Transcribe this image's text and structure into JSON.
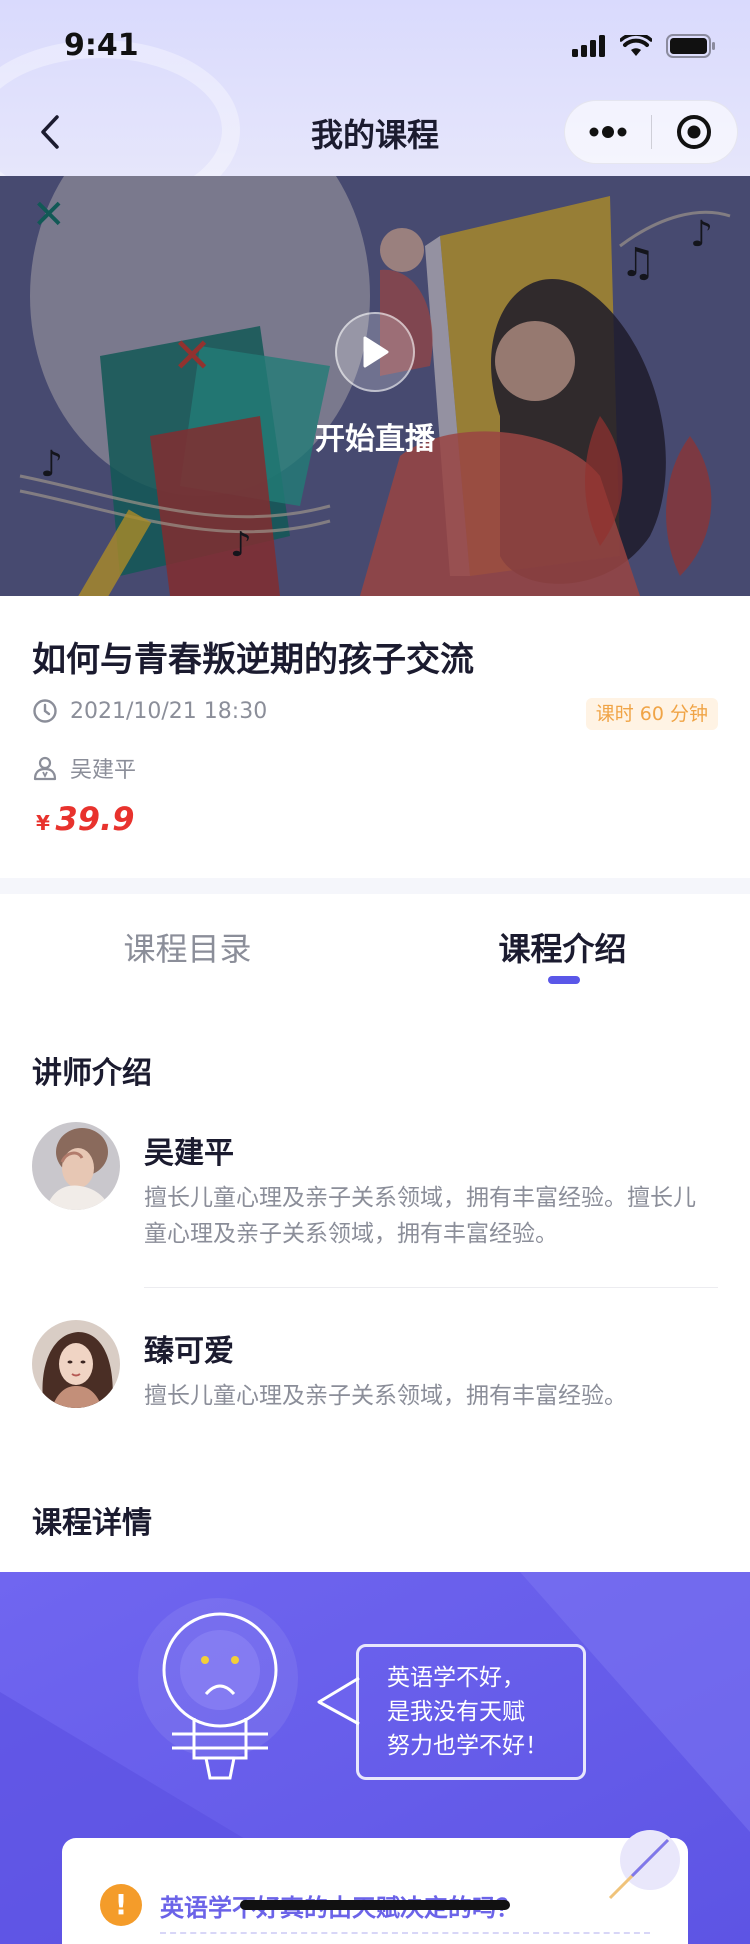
{
  "status_bar": {
    "time": "9:41",
    "icons": [
      "signal-icon",
      "wifi-icon",
      "battery-icon"
    ]
  },
  "nav": {
    "title": "我的课程",
    "back_icon": "chevron-left-icon",
    "more_icon": "more-dots-icon",
    "close_icon": "target-icon"
  },
  "hero": {
    "play_label": "开始直播",
    "play_icon": "play-icon"
  },
  "course": {
    "title": "如何与青春叛逆期的孩子交流",
    "datetime": "2021/10/21 18:30",
    "duration": "课时 60 分钟",
    "teacher": "吴建平",
    "price_symbol": "¥",
    "price": "39.9"
  },
  "tabs": [
    {
      "label": "课程目录",
      "active": false
    },
    {
      "label": "课程介绍",
      "active": true
    }
  ],
  "instructors_section": {
    "heading": "讲师介绍",
    "items": [
      {
        "name": "吴建平",
        "bio": "擅长儿童心理及亲子关系领域，拥有丰富经验。擅长儿童心理及亲子关系领域，拥有丰富经验。"
      },
      {
        "name": "臻可爱",
        "bio": "擅长儿童心理及亲子关系领域，拥有丰富经验。"
      }
    ]
  },
  "detail_section": {
    "heading": "课程详情",
    "bubble_lines": [
      "英语学不好，",
      "是我没有天赋",
      "努力也学不好！"
    ],
    "question": "英语学不好真的由天赋决定的吗？",
    "question_icon": "exclamation-icon"
  },
  "colors": {
    "accent": "#5a57e8",
    "price": "#e8322d",
    "badge_bg": "#fff3e4",
    "badge_text": "#f0a446",
    "banner": "#6d63ee"
  }
}
